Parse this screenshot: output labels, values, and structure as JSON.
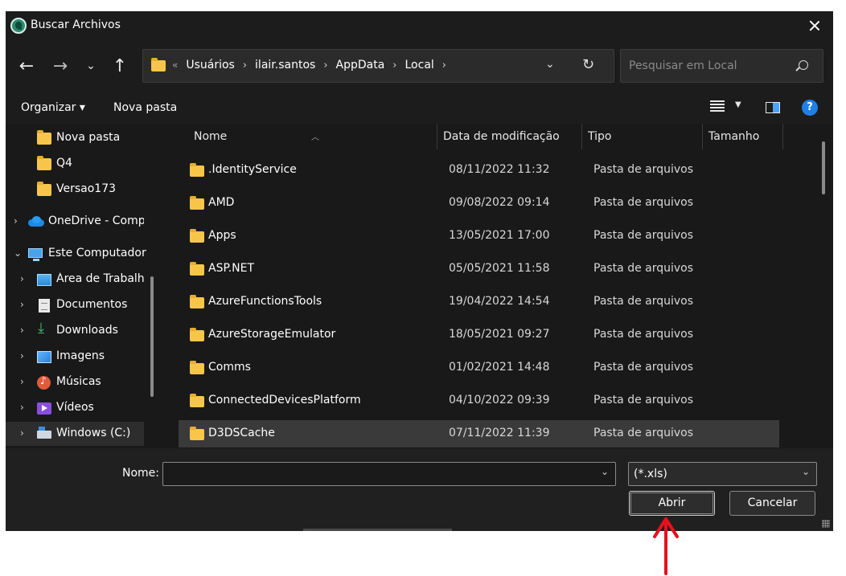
{
  "window": {
    "title": "Buscar Archivos"
  },
  "address": {
    "crumbs": [
      "Usuários",
      "ilair.santos",
      "AppData",
      "Local"
    ],
    "overflow": "«",
    "search_placeholder": "Pesquisar em Local"
  },
  "toolbar": {
    "organize": "Organizar ▾",
    "new_folder": "Nova pasta"
  },
  "sidebar": {
    "items": [
      {
        "label": "Nova pasta",
        "icon": "folder-icon",
        "expandable": false
      },
      {
        "label": "Q4",
        "icon": "folder-icon",
        "expandable": false
      },
      {
        "label": "Versao173",
        "icon": "folder-icon",
        "expandable": false
      },
      {
        "label": "OneDrive - Compu",
        "icon": "onedrive-icon",
        "expandable": true,
        "expanded": false
      },
      {
        "label": "Este Computador",
        "icon": "computer-icon",
        "expandable": true,
        "expanded": true
      },
      {
        "label": "Área de Trabalho",
        "icon": "desktop-icon",
        "expandable": true,
        "expanded": false
      },
      {
        "label": "Documentos",
        "icon": "documents-icon",
        "expandable": true,
        "expanded": false
      },
      {
        "label": "Downloads",
        "icon": "downloads-icon",
        "expandable": true,
        "expanded": false
      },
      {
        "label": "Imagens",
        "icon": "pictures-icon",
        "expandable": true,
        "expanded": false
      },
      {
        "label": "Músicas",
        "icon": "music-icon",
        "expandable": true,
        "expanded": false
      },
      {
        "label": "Vídeos",
        "icon": "videos-icon",
        "expandable": true,
        "expanded": false
      },
      {
        "label": "Windows (C:)",
        "icon": "drive-icon",
        "expandable": true,
        "expanded": false,
        "selected": true
      }
    ]
  },
  "files": {
    "columns": {
      "name": "Nome",
      "date": "Data de modificação",
      "type": "Tipo",
      "size": "Tamanho"
    },
    "rows": [
      {
        "name": ".IdentityService",
        "date": "08/11/2022 11:32",
        "type": "Pasta de arquivos"
      },
      {
        "name": "AMD",
        "date": "09/08/2022 09:14",
        "type": "Pasta de arquivos"
      },
      {
        "name": "Apps",
        "date": "13/05/2021 17:00",
        "type": "Pasta de arquivos"
      },
      {
        "name": "ASP.NET",
        "date": "05/05/2021 11:58",
        "type": "Pasta de arquivos"
      },
      {
        "name": "AzureFunctionsTools",
        "date": "19/04/2022 14:54",
        "type": "Pasta de arquivos"
      },
      {
        "name": "AzureStorageEmulator",
        "date": "18/05/2021 09:27",
        "type": "Pasta de arquivos"
      },
      {
        "name": "Comms",
        "date": "01/02/2021 14:48",
        "type": "Pasta de arquivos"
      },
      {
        "name": "ConnectedDevicesPlatform",
        "date": "04/10/2022 09:39",
        "type": "Pasta de arquivos"
      },
      {
        "name": "D3DSCache",
        "date": "07/11/2022 11:39",
        "type": "Pasta de arquivos",
        "selected": true
      }
    ]
  },
  "footer": {
    "name_label": "Nome:",
    "name_value": "",
    "filter": "(*.xls)",
    "open": "Abrir",
    "cancel": "Cancelar"
  },
  "annotation_color": "#e8101c"
}
